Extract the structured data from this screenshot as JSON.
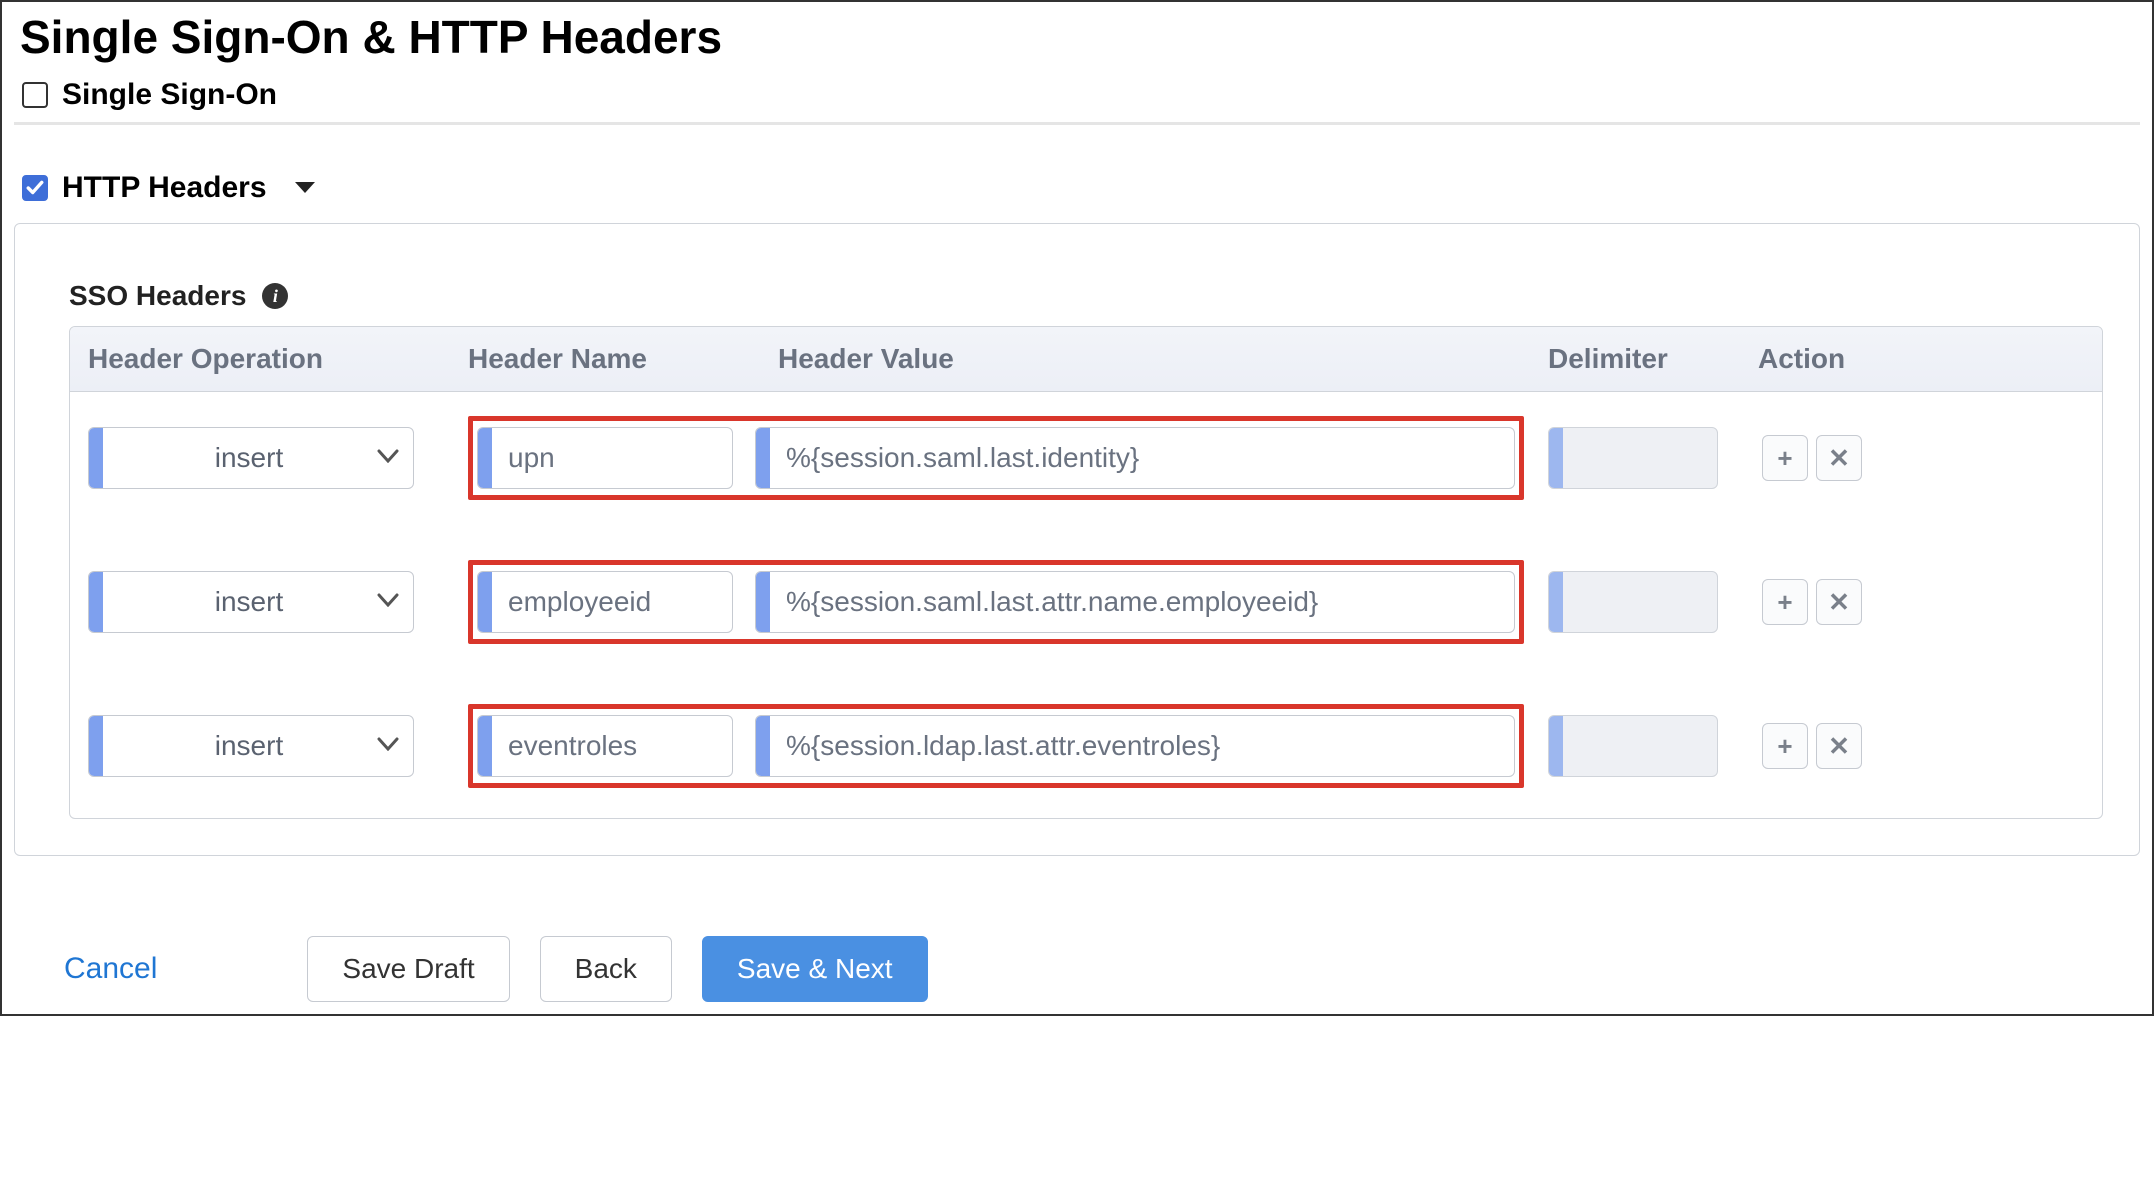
{
  "page_title": "Single Sign-On & HTTP Headers",
  "section_sso": {
    "label": "Single Sign-On",
    "checked": false
  },
  "section_http": {
    "label": "HTTP Headers",
    "checked": true
  },
  "sso_headers_label": "SSO Headers",
  "columns": {
    "operation": "Header Operation",
    "name": "Header Name",
    "value": "Header Value",
    "delimiter": "Delimiter",
    "action": "Action"
  },
  "rows": [
    {
      "operation": "insert",
      "name": "upn",
      "value": "%{session.saml.last.identity}",
      "delimiter": ""
    },
    {
      "operation": "insert",
      "name": "employeeid",
      "value": "%{session.saml.last.attr.name.employeeid}",
      "delimiter": ""
    },
    {
      "operation": "insert",
      "name": "eventroles",
      "value": "%{session.ldap.last.attr.eventroles}",
      "delimiter": ""
    }
  ],
  "footer": {
    "cancel": "Cancel",
    "save_draft": "Save Draft",
    "back": "Back",
    "save_next": "Save & Next"
  },
  "icons": {
    "info": "i",
    "add": "+",
    "remove": "✕"
  }
}
